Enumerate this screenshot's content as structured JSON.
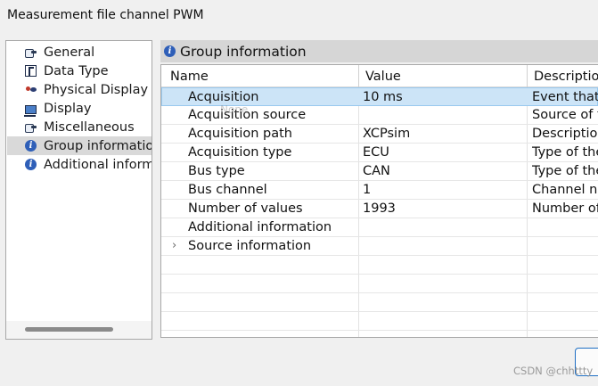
{
  "window": {
    "title": "Measurement file channel PWM"
  },
  "sidebar": {
    "items": [
      {
        "label": "General",
        "icon": "hand-pointer-icon",
        "selected": false
      },
      {
        "label": "Data Type",
        "icon": "data-type-icon",
        "selected": false
      },
      {
        "label": "Physical Display",
        "icon": "physical-display-icon",
        "selected": false
      },
      {
        "label": "Display",
        "icon": "monitor-icon",
        "selected": false
      },
      {
        "label": "Miscellaneous",
        "icon": "hand-pointer-icon",
        "selected": false
      },
      {
        "label": "Group information",
        "icon": "info-icon",
        "selected": true
      },
      {
        "label": "Additional inform",
        "icon": "info-icon",
        "selected": false
      }
    ]
  },
  "panel": {
    "title": "Group information",
    "icon": "info-icon",
    "columns": {
      "name": "Name",
      "value": "Value",
      "description": "Descriptio"
    },
    "rows": [
      {
        "name": "Acquisition",
        "value": "10 ms",
        "description": "Event that t",
        "selected": true
      },
      {
        "name": "Acquisition source",
        "value": "",
        "description": "Source of t"
      },
      {
        "name": "Acquisition path",
        "value": "XCPsim",
        "description": "Descriptio"
      },
      {
        "name": "Acquisition type",
        "value": "ECU",
        "description": "Type of the"
      },
      {
        "name": "Bus type",
        "value": "CAN",
        "description": "Type of the"
      },
      {
        "name": "Bus channel",
        "value": "1",
        "description": "Channel nu"
      },
      {
        "name": "Number of values",
        "value": "1993",
        "description": "Number of"
      },
      {
        "name": "Additional information",
        "value": "",
        "description": ""
      },
      {
        "name": "Source information",
        "value": "",
        "description": "",
        "expandable": true,
        "expander": "›"
      }
    ],
    "ghost_text": "None"
  },
  "watermark": "CSDN @chhttty",
  "colors": {
    "selection": "#cce4f7",
    "selection_border": "#99c9ef",
    "sidebar_selected": "#d9d9d9",
    "header_bg": "#d6d6d6",
    "accent": "#1f6fc4"
  }
}
